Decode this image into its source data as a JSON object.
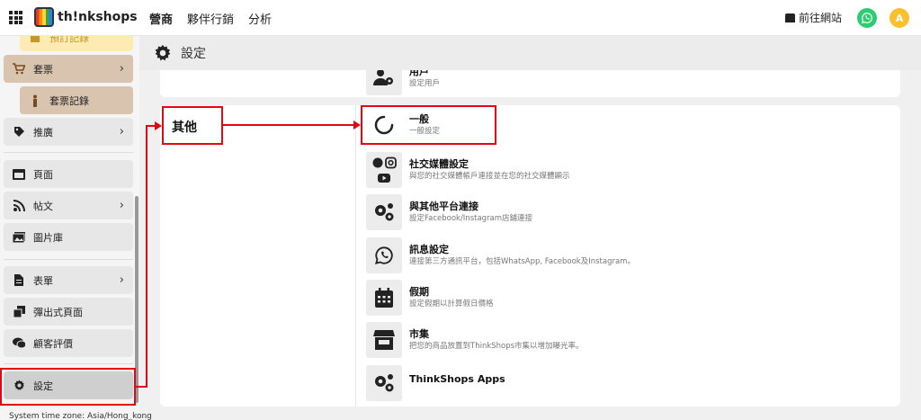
{
  "topbar": {
    "logo_text": "th!nkshops",
    "nav": [
      "營商",
      "夥伴行銷",
      "分析"
    ],
    "goto_site": "前往網站",
    "avatar_letter": "A"
  },
  "sidebar": {
    "items": {
      "partial_top": "預訂記錄",
      "package": "套票",
      "package_records": "套票記錄",
      "promotion": "推廣",
      "pages": "頁面",
      "posts": "帖文",
      "gallery": "圖片庫",
      "forms": "表單",
      "popup_pages": "彈出式頁面",
      "reviews": "顧客評價",
      "settings": "設定"
    },
    "timezone": "System time zone: Asia/Hong_kong"
  },
  "page_header": {
    "title": "設定"
  },
  "top_card": {
    "title": "用戶",
    "desc": "設定用戶"
  },
  "section": {
    "label": "其他"
  },
  "settings": [
    {
      "title": "一般",
      "desc": "一般設定",
      "icon": "circle-notch-icon"
    },
    {
      "title": "社交媒體設定",
      "desc": "與您的社交媒體帳戶連接並在您的社交媒體顯示",
      "icon": "social-media-icon"
    },
    {
      "title": "與其他平台連接",
      "desc": "設定Facebook/Instagram店鋪連接",
      "icon": "cogs-icon"
    },
    {
      "title": "訊息設定",
      "desc": "連接第三方通訊平台，包括WhatsApp, Facebook及Instagram。",
      "icon": "whatsapp-icon"
    },
    {
      "title": "假期",
      "desc": "設定假期以計算假日價格",
      "icon": "calendar-icon"
    },
    {
      "title": "市集",
      "desc": "把您的商品放置到ThinkShops市集以增加曝光率。",
      "icon": "store-icon"
    },
    {
      "title": "ThinkShops Apps",
      "desc": "",
      "icon": "cogs-icon"
    }
  ],
  "colors": {
    "annotation": "#e30613",
    "whatsapp": "#2ecc71",
    "avatar": "#fbc02d",
    "sidebar_brown": "#d9c4b0"
  }
}
